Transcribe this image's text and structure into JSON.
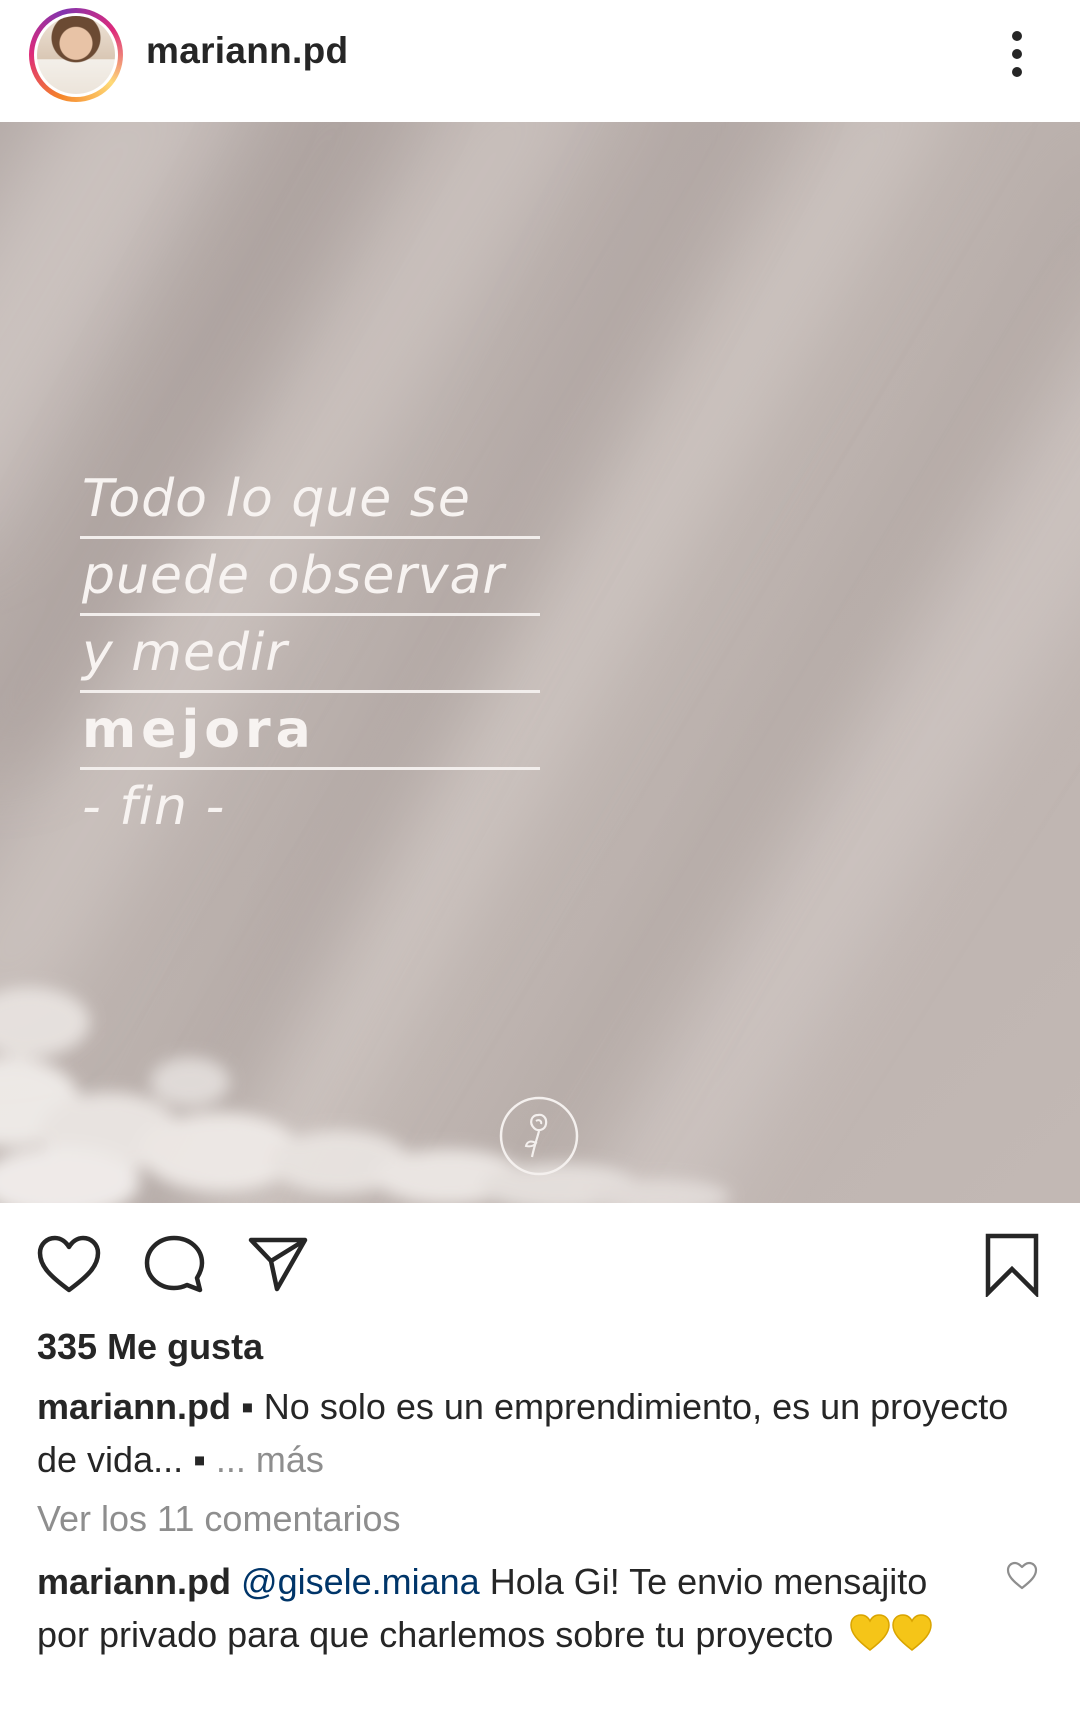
{
  "header": {
    "username": "mariann.pd",
    "more_icon": "more-vertical-icon"
  },
  "post": {
    "quote_lines": [
      "Todo lo que se",
      "puede observar",
      "y medir",
      "mejora",
      "- fin -"
    ],
    "logo_icon": "rose-logo-icon"
  },
  "actions": {
    "like_icon": "heart-icon",
    "comment_icon": "comment-bubble-icon",
    "share_icon": "send-icon",
    "save_icon": "bookmark-icon"
  },
  "likes": {
    "text": "335 Me gusta"
  },
  "caption": {
    "username": "mariann.pd",
    "text": "▪ No solo es un emprendimiento, es un proyecto de vida... ▪",
    "more": "... más"
  },
  "comments": {
    "view_all": "Ver los 11 comentarios",
    "items": [
      {
        "username": "mariann.pd",
        "mention": "@gisele.miana",
        "text": "Hola Gi! Te envio mensajito por privado para que charlemos sobre tu proyecto",
        "emoji": "💛💛",
        "like_icon": "small-heart-icon"
      }
    ]
  },
  "colors": {
    "text": "#262626",
    "muted": "#8e8e8e",
    "mention": "#003569",
    "post_background": "#b5aba8"
  }
}
